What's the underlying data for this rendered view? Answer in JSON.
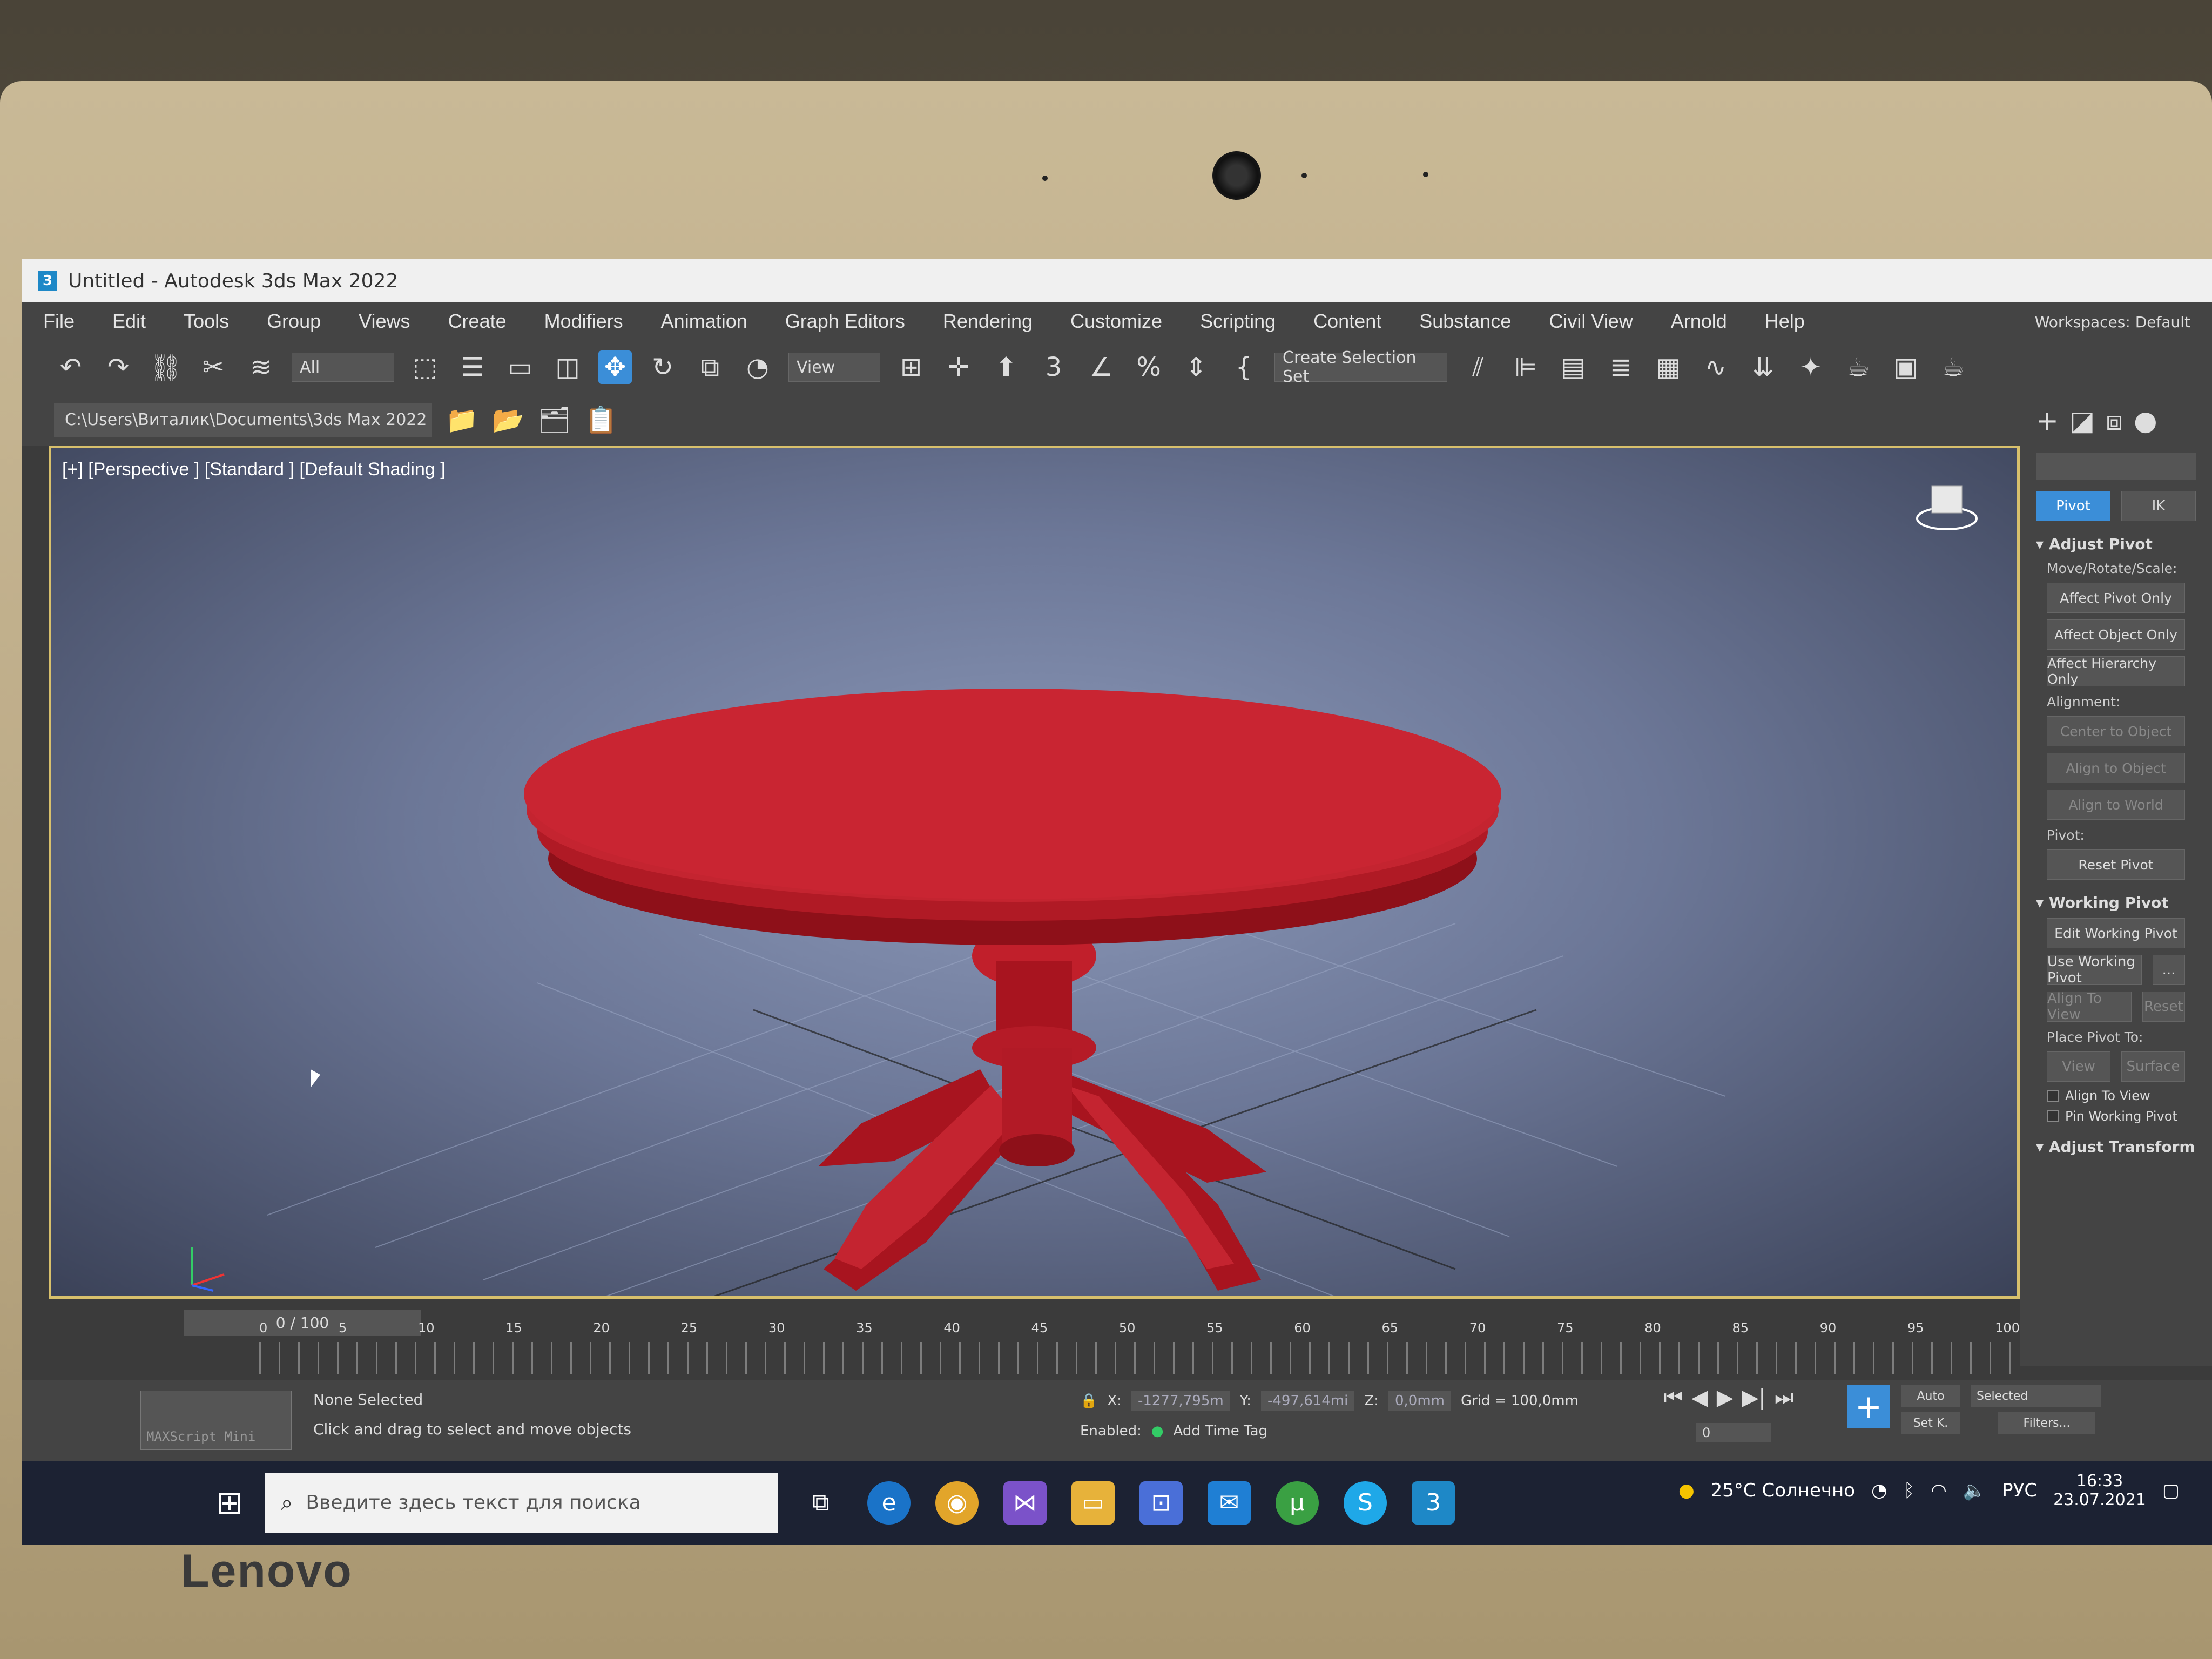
{
  "window": {
    "title": "Untitled - Autodesk 3ds Max 2022",
    "app_icon_text": "3"
  },
  "menu": [
    "File",
    "Edit",
    "Tools",
    "Group",
    "Views",
    "Create",
    "Modifiers",
    "Animation",
    "Graph Editors",
    "Rendering",
    "Customize",
    "Scripting",
    "Content",
    "Substance",
    "Civil View",
    "Arnold",
    "Help"
  ],
  "workspace": {
    "label": "Workspaces:",
    "value": "Default"
  },
  "toolbar": {
    "filter_value": "All",
    "refcoord_value": "View",
    "selection_set_value": "Create Selection Set",
    "snaps_label": "3",
    "percent_label": "%"
  },
  "project_path": "C:\\Users\\Виталик\\Documents\\3ds Max 2022",
  "viewport": {
    "label": "[+] [Perspective ] [Standard ] [Default Shading ]",
    "object_color": "#c0202e"
  },
  "command_panel": {
    "tab_pivot": "Pivot",
    "tab_ik": "IK",
    "adjust_pivot": "Adjust Pivot",
    "move_rotate_scale": "Move/Rotate/Scale:",
    "affect_pivot_only": "Affect Pivot Only",
    "affect_object_only": "Affect Object Only",
    "affect_hierarchy_only": "Affect Hierarchy Only",
    "alignment": "Alignment:",
    "center_to_object": "Center to Object",
    "align_to_object": "Align to Object",
    "align_to_world": "Align to World",
    "pivot": "Pivot:",
    "reset_pivot": "Reset Pivot",
    "working_pivot": "Working Pivot",
    "edit_working_pivot": "Edit Working Pivot",
    "use_working_pivot": "Use Working Pivot",
    "more": "...",
    "align_to_view": "Align To View",
    "reset": "Reset",
    "place_pivot_to": "Place Pivot To:",
    "view": "View",
    "surface": "Surface",
    "align_to_view_check": "Align To View",
    "pin_working_pivot": "Pin Working Pivot",
    "adjust_transform": "Adjust Transform"
  },
  "timeline": {
    "slider": "0 / 100",
    "ticks": [
      "0",
      "5",
      "10",
      "15",
      "20",
      "25",
      "30",
      "35",
      "40",
      "45",
      "50",
      "55",
      "60",
      "65",
      "70",
      "75",
      "80",
      "85",
      "90",
      "95",
      "100"
    ]
  },
  "status": {
    "maxscript": "MAXScript Mini",
    "selection": "None Selected",
    "prompt": "Click and drag to select and move objects",
    "x_label": "X:",
    "x_value": "-1277,795m",
    "y_label": "Y:",
    "y_value": "-497,614mi",
    "z_label": "Z:",
    "z_value": "0,0mm",
    "grid": "Grid = 100,0mm",
    "enabled": "Enabled:",
    "add_time_tag": "Add Time Tag",
    "auto": "Auto",
    "set_key": "Set K.",
    "selected": "Selected",
    "filters": "Filters...",
    "frame": "0"
  },
  "taskbar": {
    "search_placeholder": "Введите здесь текст для поиска",
    "weather": "25°C Солнечно",
    "lang": "РУС",
    "time": "16:33",
    "date": "23.07.2021"
  },
  "bezel_brand": "Lenovo"
}
